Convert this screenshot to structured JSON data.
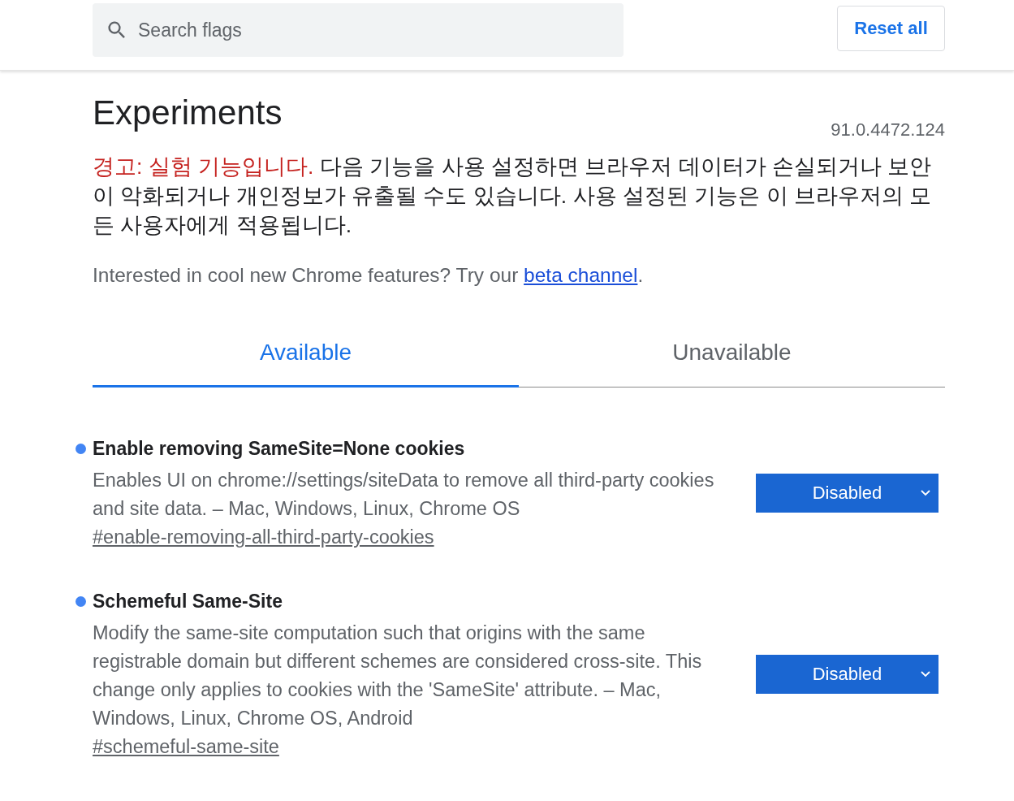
{
  "header": {
    "search": {
      "placeholder": "Search flags"
    },
    "reset_button": "Reset all"
  },
  "title": "Experiments",
  "version": "91.0.4472.124",
  "warning": {
    "label": "경고: 실험 기능입니다.",
    "text": "다음 기능을 사용 설정하면 브라우저 데이터가 손실되거나 보안이 악화되거나 개인정보가 유출될 수도 있습니다. 사용 설정된 기능은 이 브라우저의 모든 사용자에게 적용됩니다."
  },
  "intro": {
    "text": "Interested in cool new Chrome features? Try our ",
    "link": "beta channel",
    "after": "."
  },
  "tabs": [
    {
      "label": "Available",
      "selected": true
    },
    {
      "label": "Unavailable",
      "selected": false
    }
  ],
  "flags": [
    {
      "name": "Enable removing SameSite=None cookies",
      "description": "Enables UI on chrome://settings/siteData to remove all third-party cookies and site data. – Mac, Windows, Linux, Chrome OS",
      "anchor": "#enable-removing-all-third-party-cookies",
      "value": "Disabled"
    },
    {
      "name": "Schemeful Same-Site",
      "description": "Modify the same-site computation such that origins with the same registrable domain but different schemes are considered cross-site. This change only applies to cookies with the 'SameSite' attribute. – Mac, Windows, Linux, Chrome OS, Android",
      "anchor": "#schemeful-same-site",
      "value": "Disabled"
    }
  ]
}
